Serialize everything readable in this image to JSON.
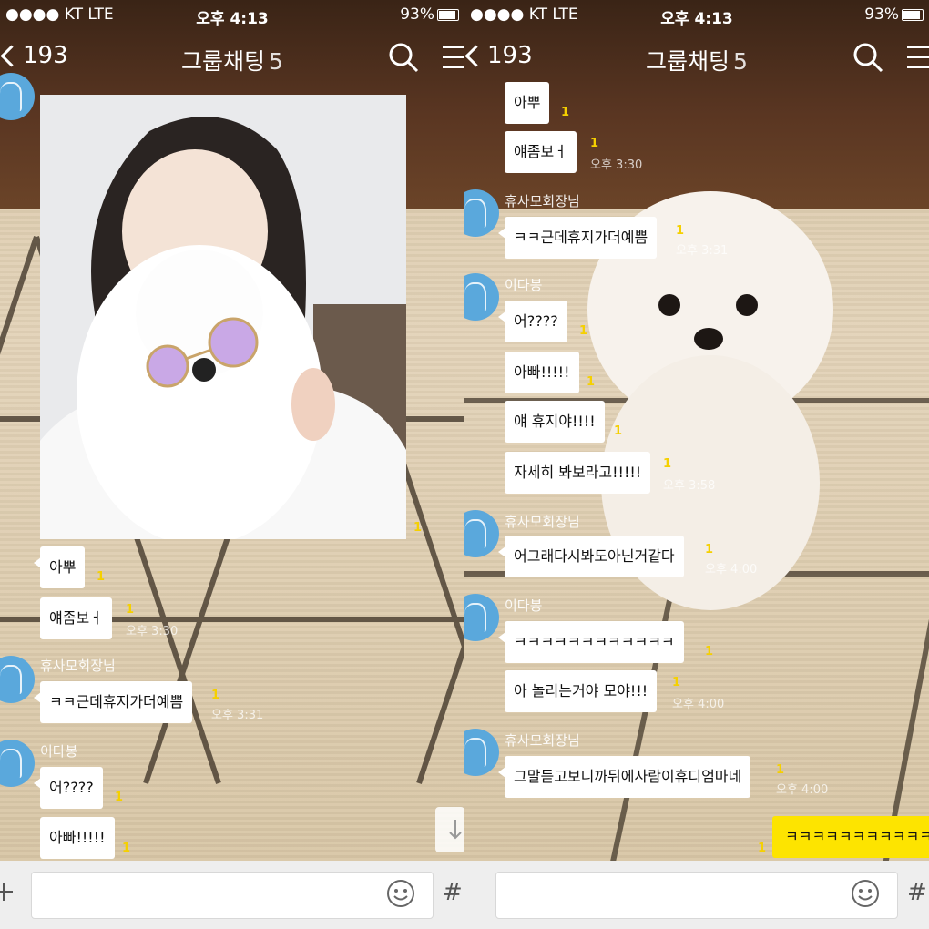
{
  "status_bar": {
    "carrier": "●●●● KT  LTE",
    "time": "오후 4:13",
    "battery": "93%"
  },
  "nav": {
    "back_count": "193",
    "title": "그룹채팅",
    "member_count": "5"
  },
  "left_chat": {
    "unread_photo": "1",
    "messages": [
      {
        "text": "아뿌",
        "unread": "1"
      },
      {
        "text": "얘좀보ㅓ",
        "unread": "1",
        "time": "오후 3:30"
      },
      {
        "sender": "휴사모회장님",
        "text": "ㅋㅋ근데휴지가더예쁨",
        "unread": "1",
        "time": "오후 3:31"
      },
      {
        "sender": "이다봉",
        "text": "어????",
        "unread": "1"
      },
      {
        "text": "아빠!!!!!",
        "unread": "1"
      }
    ]
  },
  "right_chat": {
    "messages": [
      {
        "text": "아뿌",
        "unread": "1"
      },
      {
        "text": "얘좀보ㅓ",
        "unread": "1",
        "time": "오후 3:30"
      },
      {
        "sender": "휴사모회장님",
        "text": "ㅋㅋ근데휴지가더예쁨",
        "unread": "1",
        "time": "오후 3:31"
      },
      {
        "sender": "이다봉",
        "text": "어????",
        "unread": "1"
      },
      {
        "text": "아빠!!!!!",
        "unread": "1"
      },
      {
        "text": "얘 휴지야!!!!",
        "unread": "1"
      },
      {
        "text": "자세히 봐보라고!!!!!",
        "unread": "1",
        "time": "오후 3:58"
      },
      {
        "sender": "휴사모회장님",
        "text": "어그래다시봐도아닌거같다",
        "unread": "1",
        "time": "오후 4:00"
      },
      {
        "sender": "이다봉",
        "text": "ㅋㅋㅋㅋㅋㅋㅋㅋㅋㅋㅋㅋ",
        "unread": "1"
      },
      {
        "text": "아 놀리는거야 모야!!!",
        "unread": "1",
        "time": "오후 4:00"
      },
      {
        "sender": "휴사모회장님",
        "text": "그말듣고보니까뒤에사람이휴디엄마네",
        "unread": "1",
        "time": "오후 4:00"
      }
    ],
    "my_message": {
      "text": "ㅋㅋㅋㅋㅋㅋㅋㅋㅋㅋㅋ",
      "unread": "1"
    }
  },
  "input_bar": {
    "hash_symbol": "#"
  },
  "colors": {
    "unread": "#f5d000",
    "my_bubble": "#fde400",
    "avatar": "#5aa8dc",
    "input_bar": "#eeeeee"
  },
  "icons": [
    "chevron-left-icon",
    "search-icon",
    "menu-icon",
    "plus-icon",
    "emoji-icon",
    "scroll-down-icon",
    "send-icon"
  ]
}
